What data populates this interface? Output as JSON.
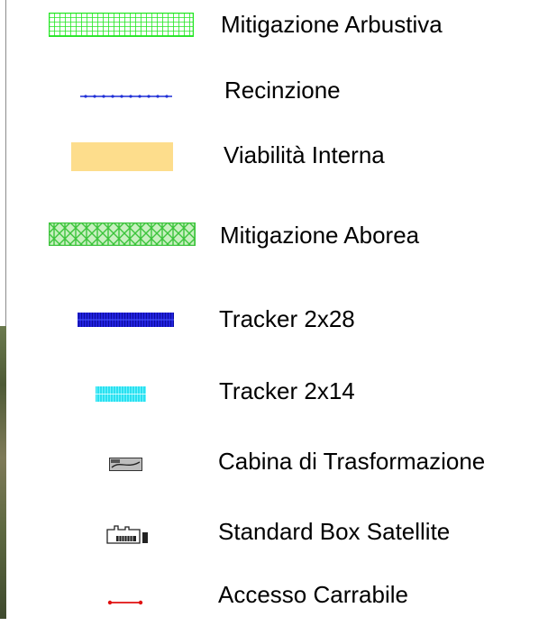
{
  "legend": {
    "items": [
      {
        "label": "Mitigazione Arbustiva",
        "icon": "green-grid-hatch-icon",
        "color": "#22e622"
      },
      {
        "label": "Recinzione",
        "icon": "blue-dotted-line-icon",
        "color": "#1f2fd6"
      },
      {
        "label": "Viabilità Interna",
        "icon": "tan-rectangle-icon",
        "color": "#fddd8c"
      },
      {
        "label": "Mitigazione Aborea",
        "icon": "green-crosshatch-icon",
        "color": "#3cc43c"
      },
      {
        "label": "Tracker 2x28",
        "icon": "blue-tracker-icon",
        "color": "#1a1acc"
      },
      {
        "label": "Tracker 2x14",
        "icon": "cyan-tracker-icon",
        "color": "#2ae0f0"
      },
      {
        "label": "Cabina di Trasformazione",
        "icon": "transformer-cabin-icon",
        "color": "#555555"
      },
      {
        "label": "Standard Box Satellite",
        "icon": "satellite-box-icon",
        "color": "#222222"
      },
      {
        "label": "Accesso Carrabile",
        "icon": "red-access-line-icon",
        "color": "#e01010"
      }
    ]
  }
}
